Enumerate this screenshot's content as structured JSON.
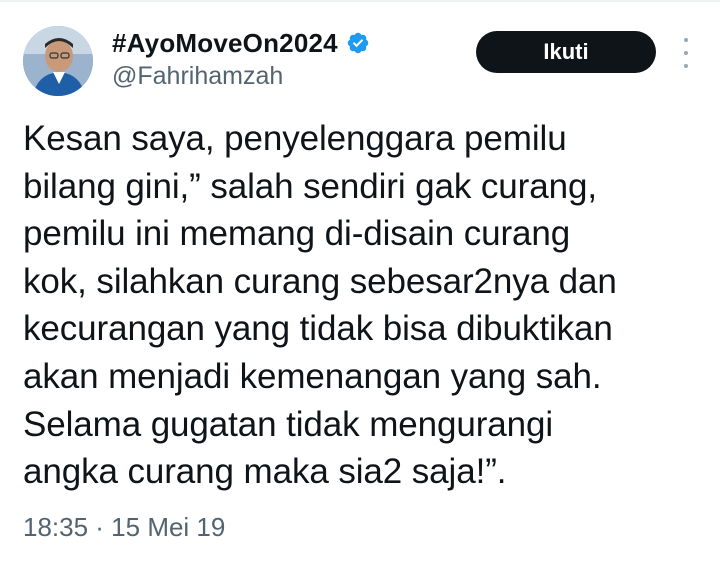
{
  "tweet": {
    "display_name": "#AyoMoveOn2024",
    "handle": "@Fahrihamzah",
    "follow_label": "Ikuti",
    "text": "Kesan saya, penyelenggara pemilu\nbilang gini,” salah sendiri gak curang,\npemilu ini memang di-disain curang\nkok, silahkan curang sebesar2nya dan\nkecurangan yang tidak bisa dibuktikan\nakan menjadi kemenangan yang sah.\nSelama gugatan tidak mengurangi\nangka curang maka sia2 saja!”.",
    "timestamp": "18:35 · 15 Mei 19"
  },
  "icons": {
    "verified": "verified-badge-icon",
    "more": "more-vertical-icon"
  },
  "colors": {
    "verified_blue": "#1d9bf0",
    "follow_button_bg": "#0f1419",
    "secondary_text": "#536471"
  }
}
